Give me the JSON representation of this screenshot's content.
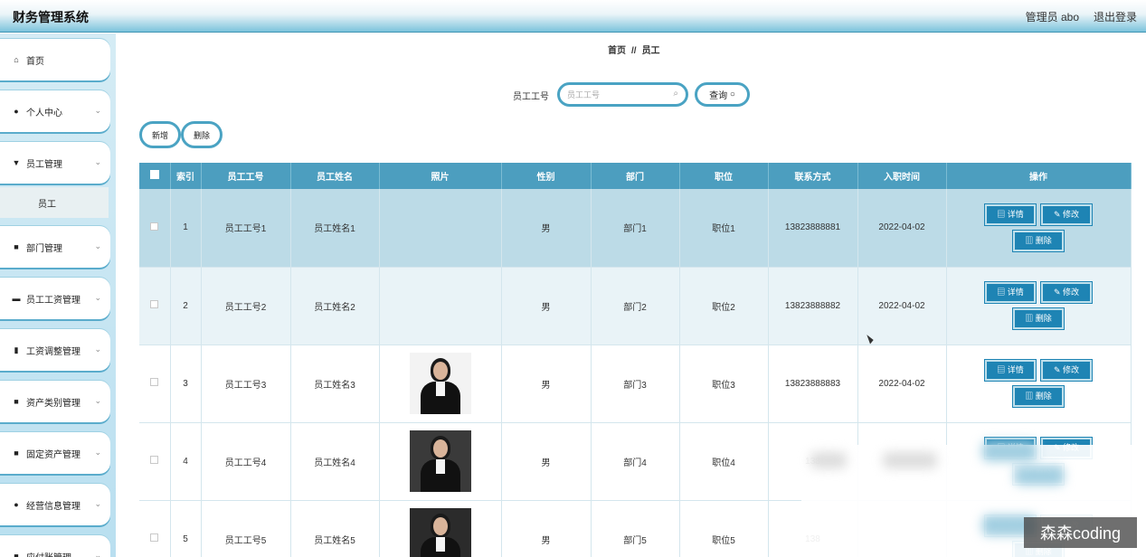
{
  "header": {
    "title": "财务管理系统",
    "user": "管理员 abo",
    "logout": "退出登录"
  },
  "sidebar": {
    "items": [
      {
        "label": "首页",
        "icon": "home-icon",
        "glyph": "⌂",
        "expandable": false
      },
      {
        "label": "个人中心",
        "icon": "person-icon",
        "glyph": "●",
        "expandable": true
      },
      {
        "label": "员工管理",
        "icon": "pin-icon",
        "glyph": "▼",
        "expandable": true
      },
      {
        "label": "部门管理",
        "icon": "grid-icon",
        "glyph": "■",
        "expandable": true
      },
      {
        "label": "员工工资管理",
        "icon": "briefcase-icon",
        "glyph": "▬",
        "expandable": true
      },
      {
        "label": "工资调整管理",
        "icon": "bar-chart-icon",
        "glyph": "▮",
        "expandable": true
      },
      {
        "label": "资产类别管理",
        "icon": "clipboard-icon",
        "glyph": "■",
        "expandable": true
      },
      {
        "label": "固定资产管理",
        "icon": "grid-icon",
        "glyph": "■",
        "expandable": true
      },
      {
        "label": "经营信息管理",
        "icon": "bulb-icon",
        "glyph": "●",
        "expandable": true
      },
      {
        "label": "应付账管理",
        "icon": "grid-icon",
        "glyph": "■",
        "expandable": true
      }
    ],
    "sub_item": "员工"
  },
  "breadcrumb": {
    "home": "首页",
    "sep": "//",
    "current": "员工"
  },
  "search": {
    "label": "员工工号",
    "placeholder": "员工工号",
    "button": "查询"
  },
  "actions": {
    "add": "新增",
    "delete": "删除"
  },
  "table": {
    "headers": [
      "索引",
      "员工工号",
      "员工姓名",
      "照片",
      "性别",
      "部门",
      "职位",
      "联系方式",
      "入职时间",
      "操作"
    ],
    "op_labels": {
      "detail": "详情",
      "edit": "修改",
      "delete": "删除"
    },
    "rows": [
      {
        "index": "1",
        "emp_no": "员工工号1",
        "name": "员工姓名1",
        "photo": "",
        "gender": "男",
        "dept": "部门1",
        "position": "职位1",
        "phone": "13823888881",
        "date": "2022-04-02"
      },
      {
        "index": "2",
        "emp_no": "员工工号2",
        "name": "员工姓名2",
        "photo": "",
        "gender": "男",
        "dept": "部门2",
        "position": "职位2",
        "phone": "13823888882",
        "date": "2022-04-02"
      },
      {
        "index": "3",
        "emp_no": "员工工号3",
        "name": "员工姓名3",
        "photo": "female-portrait",
        "gender": "男",
        "dept": "部门3",
        "position": "职位3",
        "phone": "13823888883",
        "date": "2022-04-02"
      },
      {
        "index": "4",
        "emp_no": "员工工号4",
        "name": "员工姓名4",
        "photo": "female-portrait",
        "gender": "男",
        "dept": "部门4",
        "position": "职位4",
        "phone": "138",
        "date": ""
      },
      {
        "index": "5",
        "emp_no": "员工工号5",
        "name": "员工姓名5",
        "photo": "male-portrait",
        "gender": "男",
        "dept": "部门5",
        "position": "职位5",
        "phone": "138",
        "date": ""
      }
    ]
  },
  "watermark": "森森coding"
}
